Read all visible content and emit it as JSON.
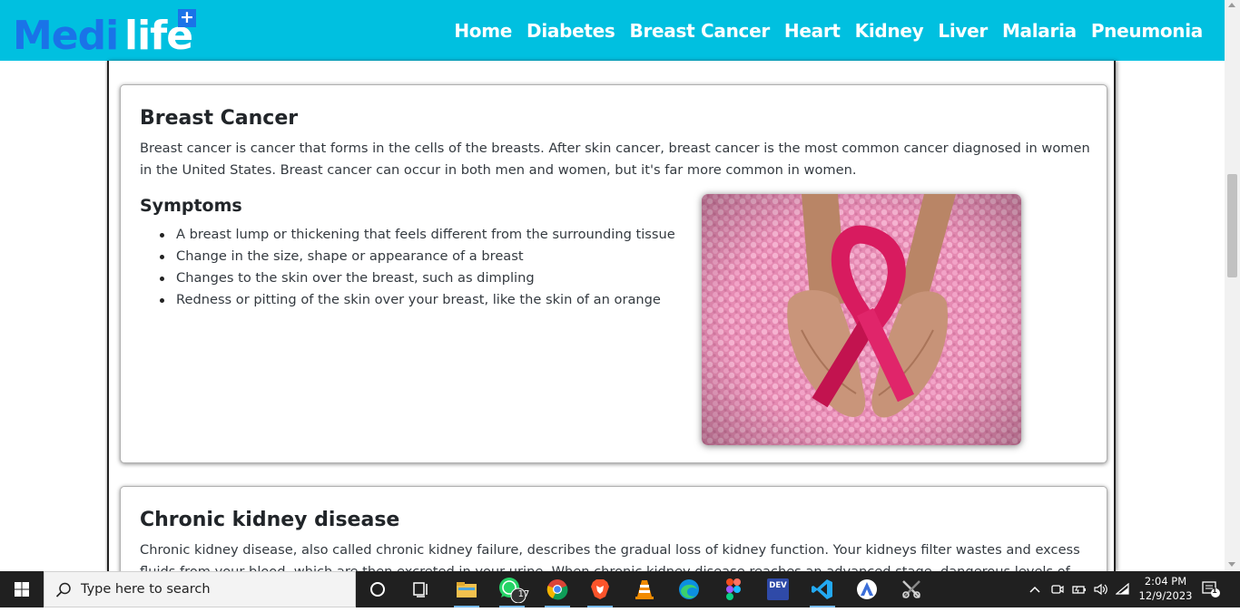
{
  "brand": {
    "logo_part1": "Medi",
    "logo_part2": "life",
    "logo_plus": "+",
    "primary_color": "#00c0e0",
    "logo_color": "#1a73e8"
  },
  "nav": {
    "items": [
      {
        "label": "Home"
      },
      {
        "label": "Diabetes"
      },
      {
        "label": "Breast Cancer"
      },
      {
        "label": "Heart"
      },
      {
        "label": "Kidney"
      },
      {
        "label": "Liver"
      },
      {
        "label": "Malaria"
      },
      {
        "label": "Pneumonia"
      }
    ]
  },
  "breast_cancer": {
    "title": "Breast Cancer",
    "description": "Breast cancer is cancer that forms in the cells of the breasts. After skin cancer, breast cancer is the most common cancer diagnosed in women in the United States. Breast cancer can occur in both men and women, but it's far more common in women.",
    "symptoms_title": "Symptoms",
    "symptoms": [
      "A breast lump or thickening that feels different from the surrounding tissue",
      "Change in the size, shape or appearance of a breast",
      "Changes to the skin over the breast, such as dimpling",
      "Redness or pitting of the skin over your breast, like the skin of an orange"
    ],
    "image_icon": "pink-ribbon-image"
  },
  "kidney": {
    "title": "Chronic kidney disease",
    "description": "Chronic kidney disease, also called chronic kidney failure, describes the gradual loss of kidney function. Your kidneys filter wastes and excess fluids from your blood, which are then excreted in your urine. When chronic kidney disease reaches an advanced stage, dangerous levels of fluid"
  },
  "taskbar": {
    "search_placeholder": "Type here to search",
    "whatsapp_badge": "17",
    "time": "2:04 PM",
    "date": "12/9/2023",
    "notification_count": "1",
    "dev_label": "DEV"
  }
}
